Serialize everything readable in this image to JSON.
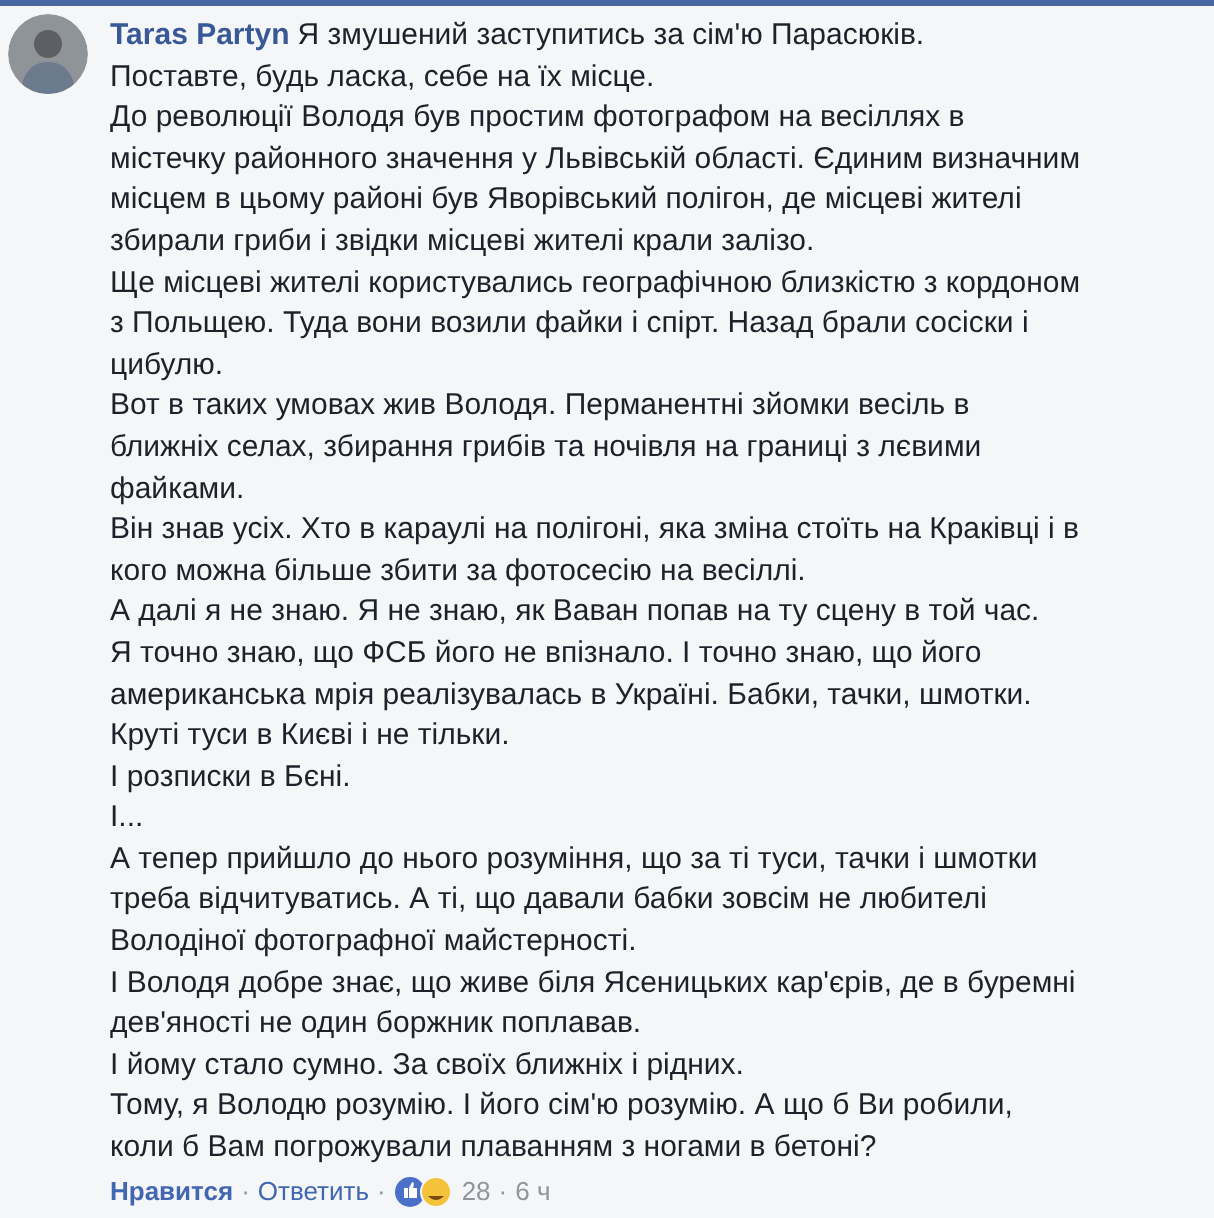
{
  "comment": {
    "author": "Taras Partyn",
    "paragraphs": [
      {
        "lines": [
          "Я змушений заступитись за сім'ю Парасюків."
        ]
      },
      {
        "lines": [
          "Поставте, будь ласка, себе на їх місце."
        ]
      },
      {
        "lines": [
          "До революції Володя був простим фотографом на весіллях в",
          "містечку районного значення у Львівській області. Єдиним визначним",
          "місцем в цьому районі був Яворівський полігон, де місцеві жителі",
          "збирали гриби і звідки місцеві жителі крали залізо."
        ]
      },
      {
        "lines": [
          "Ще місцеві жителі користувались географічною близкістю з кордоном",
          "з Польщею. Туда вони возили файки і спірт. Назад брали сосіски і",
          "цибулю."
        ]
      },
      {
        "lines": [
          "Вот в таких умовах жив Володя. Перманентні зйомки весіль в",
          "ближніх селах, збирання грибів та ночівля на границі з лєвими",
          "файками."
        ]
      },
      {
        "lines": [
          "Він знав усіх. Хто в караулі на полігоні, яка зміна стоїть на Краківці і в",
          "кого можна більше збити за фотосесію на весіллі."
        ]
      },
      {
        "lines": [
          "А далі я не знаю. Я не знаю, як Ваван попав на ту сцену в той час."
        ]
      },
      {
        "lines": [
          "Я точно знаю, що ФСБ його не впізнало. І точно знаю, що його",
          "американська мрія реалізувалась в Україні. Бабки, тачки, шмотки."
        ]
      },
      {
        "lines": [
          "Круті туси в Києві і не тільки."
        ]
      },
      {
        "lines": [
          "І розписки в Бєні."
        ]
      },
      {
        "lines": [
          "І..."
        ]
      },
      {
        "lines": [
          "А тепер прийшло до нього розуміння, що за ті туси, тачки і шмотки",
          "треба відчитуватись. А ті, що давали бабки зовсім не любителі",
          "Володіної фотографної майстерності."
        ]
      },
      {
        "lines": [
          "І Володя добре знає, що живе біля Ясеницьких кар'єрів, де в буремні",
          "дев'яності не один боржник поплавав."
        ]
      },
      {
        "lines": [
          "І йому стало сумно. За своїх ближніх і рідних."
        ]
      },
      {
        "lines": [
          "Тому, я Володю розумію. І його сім'ю розумію. А що б Ви робили,",
          "коли б Вам погрожували плаванням з ногами в бетоні?"
        ]
      }
    ],
    "actions": [
      "Нравится",
      "Ответить"
    ],
    "separator": "·",
    "reaction_count": "28",
    "time": "6 ч"
  }
}
